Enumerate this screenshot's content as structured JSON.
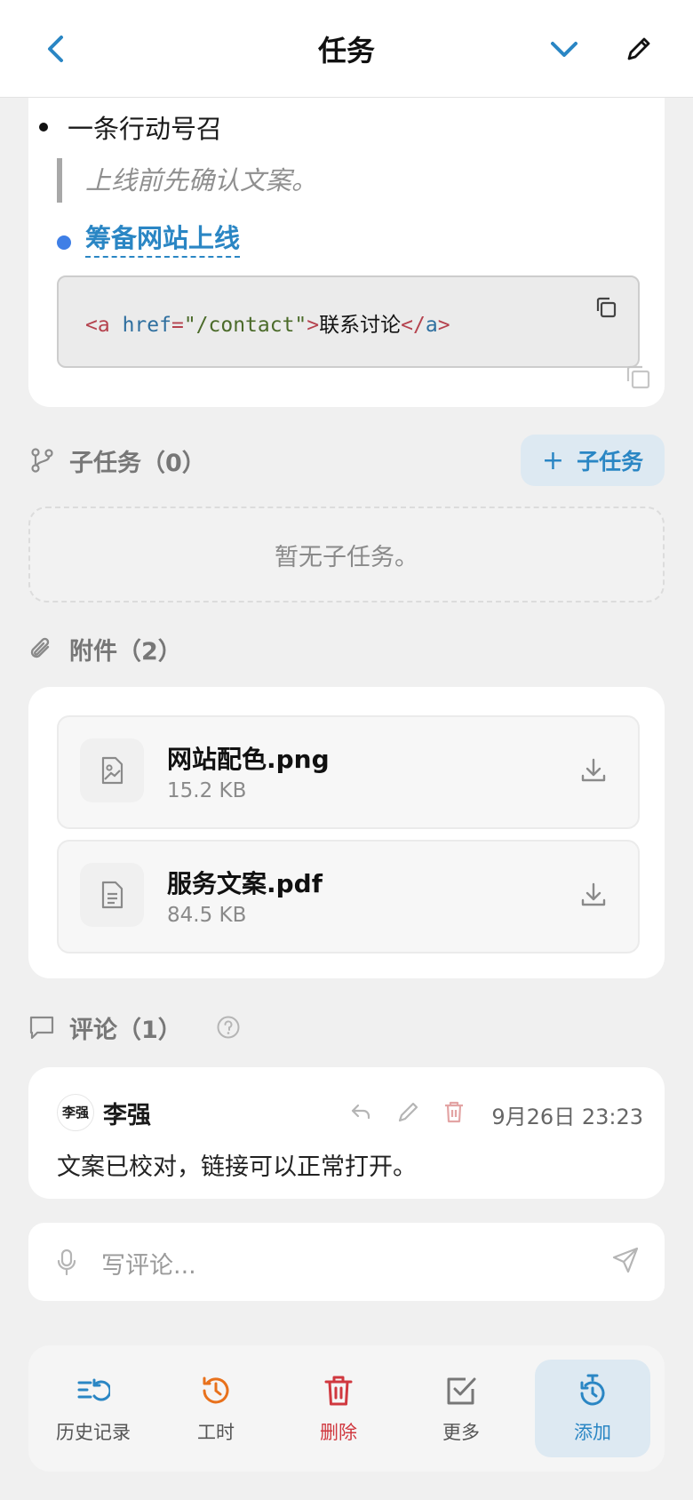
{
  "header": {
    "title": "任务",
    "accent": "#2a86c4"
  },
  "description": {
    "bullet": "一条行动号召",
    "quote": "上线前先确认文案。",
    "task_link": "筹备网站上线",
    "code": {
      "tag_open": "<a",
      "attr": "href",
      "eq": "=",
      "value": "\"/contact\"",
      "close_bracket": ">",
      "text": "联系讨论",
      "tag_close_open": "</",
      "tag_name": "a",
      "tag_close_end": ">"
    }
  },
  "subtasks": {
    "label": "子任务（0）",
    "add_label": "子任务",
    "empty": "暂无子任务。"
  },
  "attachments": {
    "label": "附件（2）",
    "files": [
      {
        "name": "网站配色.png",
        "size": "15.2 KB",
        "icon": "image-file-icon"
      },
      {
        "name": "服务文案.pdf",
        "size": "84.5 KB",
        "icon": "document-file-icon"
      }
    ]
  },
  "comments": {
    "label": "评论（1）",
    "items": [
      {
        "avatar": "李强",
        "author": "李强",
        "time": "9月26日 23:23",
        "text": "文案已校对，链接可以正常打开。"
      }
    ],
    "input_placeholder": "写评论..."
  },
  "bottom_bar": {
    "items": [
      {
        "label": "历史记录",
        "color": "#2a86c4"
      },
      {
        "label": "工时",
        "color": "#e8711c"
      },
      {
        "label": "删除",
        "color": "#d0383f"
      },
      {
        "label": "更多",
        "color": "#777777"
      },
      {
        "label": "添加",
        "color": "#2a86c4"
      }
    ]
  }
}
